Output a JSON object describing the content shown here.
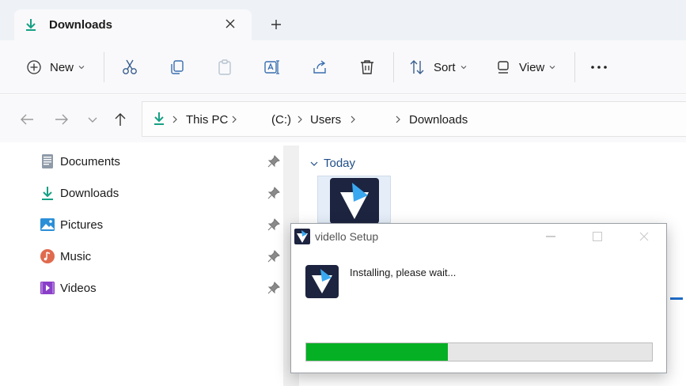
{
  "tab": {
    "title": "Downloads"
  },
  "toolbar": {
    "new_label": "New",
    "sort_label": "Sort",
    "view_label": "View"
  },
  "breadcrumb": {
    "items": [
      "This PC",
      "(C:)",
      "Users",
      "Downloads"
    ]
  },
  "sidebar": {
    "items": [
      {
        "label": "Documents",
        "icon": "documents-icon"
      },
      {
        "label": "Downloads",
        "icon": "downloads-icon"
      },
      {
        "label": "Pictures",
        "icon": "pictures-icon"
      },
      {
        "label": "Music",
        "icon": "music-icon"
      },
      {
        "label": "Videos",
        "icon": "videos-icon"
      }
    ]
  },
  "content": {
    "group_label": "Today"
  },
  "dialog": {
    "title": "vidello Setup",
    "message": "Installing, please wait...",
    "progress": 0.41
  },
  "colors": {
    "accent": "#1f6cc8",
    "download_green": "#16a085",
    "progress_green": "#06b025",
    "app_navy": "#1c2440"
  }
}
